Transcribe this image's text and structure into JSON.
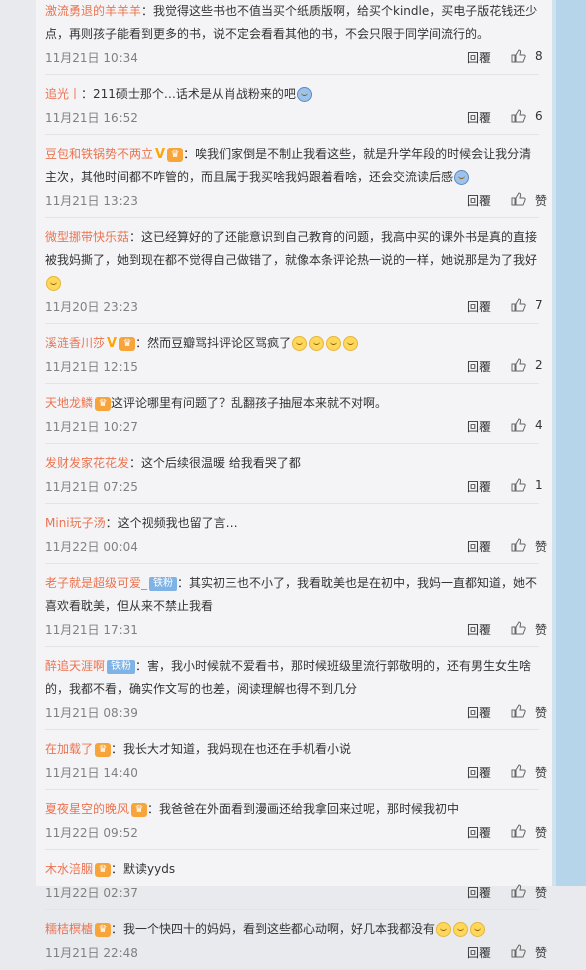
{
  "reply_label": "回覆",
  "comments": [
    {
      "user": "激流勇退的羊羊羊",
      "text": "：我觉得这些书也不值当买个纸质版啊，给买个kindle，买电子版花钱还少点，再则孩子能看到更多的书，说不定会看看其他的书，不会只限于同学间流行的。",
      "date": "11月21日 10:34",
      "likes": "8"
    },
    {
      "user": "追光丨",
      "text": "：211硕士那个…话术是从肖战粉来的吧",
      "date": "11月21日 16:52",
      "likes": "6"
    },
    {
      "user": "豆包和铁锅势不两立",
      "text": "：唉我们家倒是不制止我看这些，就是升学年段的时候会让我分清主次，其他时间都不咋管的，而且属于我买啥我妈跟着看啥，还会交流读后感",
      "date": "11月21日 13:23",
      "likes": "赞"
    },
    {
      "user": "微型挪带快乐菇",
      "text": "：这已经算好的了还能意识到自己教育的问题，我高中买的课外书是真的直接被我妈撕了，她到现在都不觉得自己做错了，就像本条评论热一说的一样，她说那是为了我好",
      "date": "11月20日 23:23",
      "likes": "7"
    },
    {
      "user": "溪涟香川莎",
      "text": "：然而豆瓣骂抖评论区骂疯了",
      "date": "11月21日 12:15",
      "likes": "2"
    },
    {
      "user": "天地龙鳞",
      "text": "这评论哪里有问题了？乱翻孩子抽屉本来就不对啊。",
      "date": "11月21日 10:27",
      "likes": "4"
    },
    {
      "user": "发财发家花花发",
      "text": "：这个后续很温暖 给我看哭了都",
      "date": "11月21日 07:25",
      "likes": "1"
    },
    {
      "user": "Mini玩子汤",
      "text": "：这个视频我也留了言…",
      "date": "11月22日 00:04",
      "likes": "赞"
    },
    {
      "user": "老子就是超级可爱_",
      "fans": "铁粉",
      "text": "：其实初三也不小了，我看耽美也是在初中，我妈一直都知道，她不喜欢看耽美，但从来不禁止我看",
      "date": "11月21日 17:31",
      "likes": "赞"
    },
    {
      "user": "醉追天涯啊",
      "fans": "铁粉",
      "text": "：害，我小时候就不爱看书，那时候班级里流行郭敬明的，还有男生女生啥的，我都不看，确实作文写的也差，阅读理解也得不到几分",
      "date": "11月21日 08:39",
      "likes": "赞"
    },
    {
      "user": "在加载了",
      "text": "：我长大才知道，我妈现在也还在手机看小说",
      "date": "11月21日 14:40",
      "likes": "赞"
    },
    {
      "user": "夏夜星空的晚风",
      "text": "：我爸爸在外面看到漫画还给我拿回来过呢，那时候我初中",
      "date": "11月22日 09:52",
      "likes": "赞"
    },
    {
      "user": "木水涪胭",
      "text": "：默读yyds",
      "date": "11月22日 02:37",
      "likes": "赞"
    },
    {
      "user": "糯桔榠樝",
      "text": "：我一个快四十的妈妈，看到这些都心动啊，好几本我都没有",
      "date": "11月21日 22:48",
      "likes": "赞"
    }
  ]
}
